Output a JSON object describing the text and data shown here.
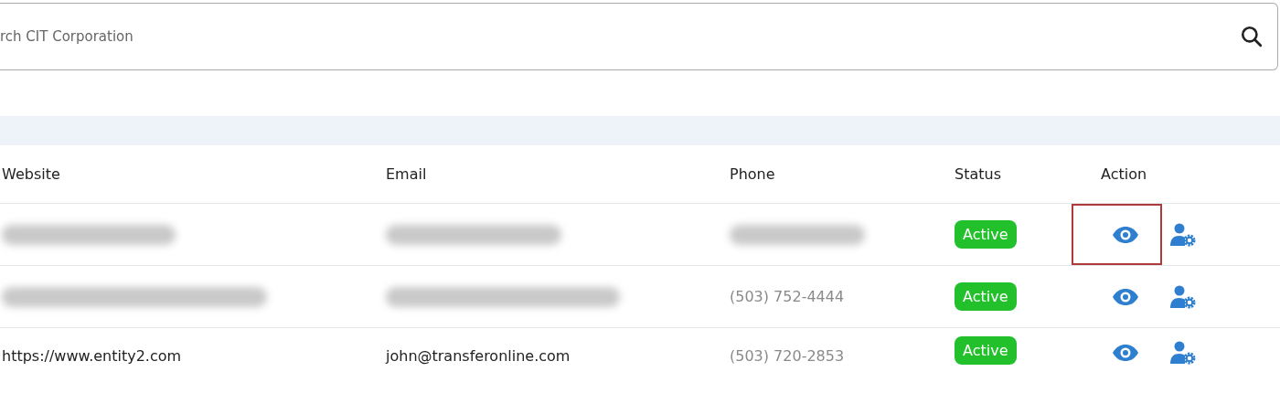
{
  "search": {
    "placeholder": "rch CIT Corporation"
  },
  "table": {
    "columns": [
      "Website",
      "Email",
      "Phone",
      "Status",
      "Action"
    ],
    "rows": [
      {
        "website": {
          "kind": "redacted"
        },
        "email": {
          "kind": "redacted"
        },
        "phone": {
          "kind": "redacted"
        },
        "status": "Active",
        "view_highlighted": true
      },
      {
        "website": {
          "kind": "redacted"
        },
        "email": {
          "kind": "redacted"
        },
        "phone": {
          "kind": "faded",
          "text": "(503) 752-4444"
        },
        "status": "Active",
        "view_highlighted": false
      },
      {
        "website": {
          "kind": "text",
          "text": "https://www.entity2.com"
        },
        "email": {
          "kind": "text",
          "text": "john@transferonline.com"
        },
        "phone": {
          "kind": "faded",
          "text": "(503) 720-2853"
        },
        "status": "Active",
        "view_highlighted": false
      }
    ]
  }
}
